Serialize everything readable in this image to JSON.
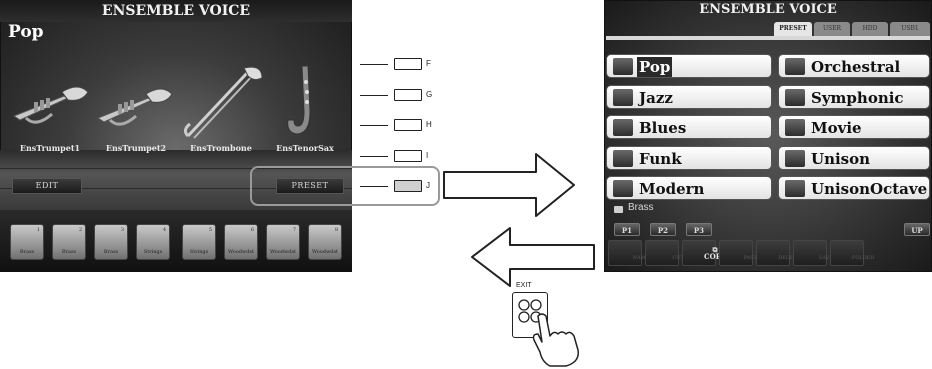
{
  "left_screen": {
    "title": "ENSEMBLE VOICE",
    "voice_name": "Pop",
    "instruments": [
      {
        "name": "EnsTrumpet1",
        "icon": "trumpet-icon"
      },
      {
        "name": "EnsTrumpet2",
        "icon": "trumpet-icon"
      },
      {
        "name": "EnsTrombone",
        "icon": "trombone-icon"
      },
      {
        "name": "EnsTenorSax",
        "icon": "saxophone-icon"
      }
    ],
    "edit_label": "EDIT",
    "preset_label": "PRESET",
    "parts": [
      {
        "num": "1",
        "label": "Brass"
      },
      {
        "num": "2",
        "label": "Brass"
      },
      {
        "num": "3",
        "label": "Brass"
      },
      {
        "num": "4",
        "label": "Strings"
      },
      {
        "num": "5",
        "label": "Strings"
      },
      {
        "num": "6",
        "label": "Woodwdst"
      },
      {
        "num": "7",
        "label": "Woodwdst"
      },
      {
        "num": "8",
        "label": "Woodwdst"
      }
    ]
  },
  "panel_keys": [
    "F",
    "G",
    "H",
    "I",
    "J"
  ],
  "highlighted_key": "J",
  "right_screen": {
    "title": "ENSEMBLE VOICE",
    "tabs": [
      "PRESET",
      "USER",
      "HDD",
      "USB1"
    ],
    "active_tab": "PRESET",
    "voices_left": [
      "Pop",
      "Jazz",
      "Blues",
      "Funk",
      "Modern"
    ],
    "voices_right": [
      "Orchestral",
      "Symphonic",
      "Movie",
      "Unison",
      "UnisonOctave"
    ],
    "selected_voice": "Pop",
    "folder_label": "Brass",
    "page_buttons": [
      "P1",
      "P2",
      "P3"
    ],
    "up_label": "UP",
    "bottom_buttons": [
      {
        "top": "",
        "label": "NAME"
      },
      {
        "top": "",
        "label": "CUT"
      },
      {
        "top": "",
        "label": "COPY"
      },
      {
        "top": "",
        "label": "PASTE"
      },
      {
        "top": "",
        "label": "DELETE"
      },
      {
        "top": "",
        "label": "SAVE"
      },
      {
        "top": "",
        "label": "FOLDER"
      }
    ],
    "active_bottom_button": "COPY"
  },
  "exit": {
    "label": "EXIT",
    "icon": "exit-button-icon"
  },
  "colors": {
    "screen_dark": "#2a2a2a",
    "tile_light": "#f0f0f0",
    "key_highlight": "#d0d0d0"
  }
}
